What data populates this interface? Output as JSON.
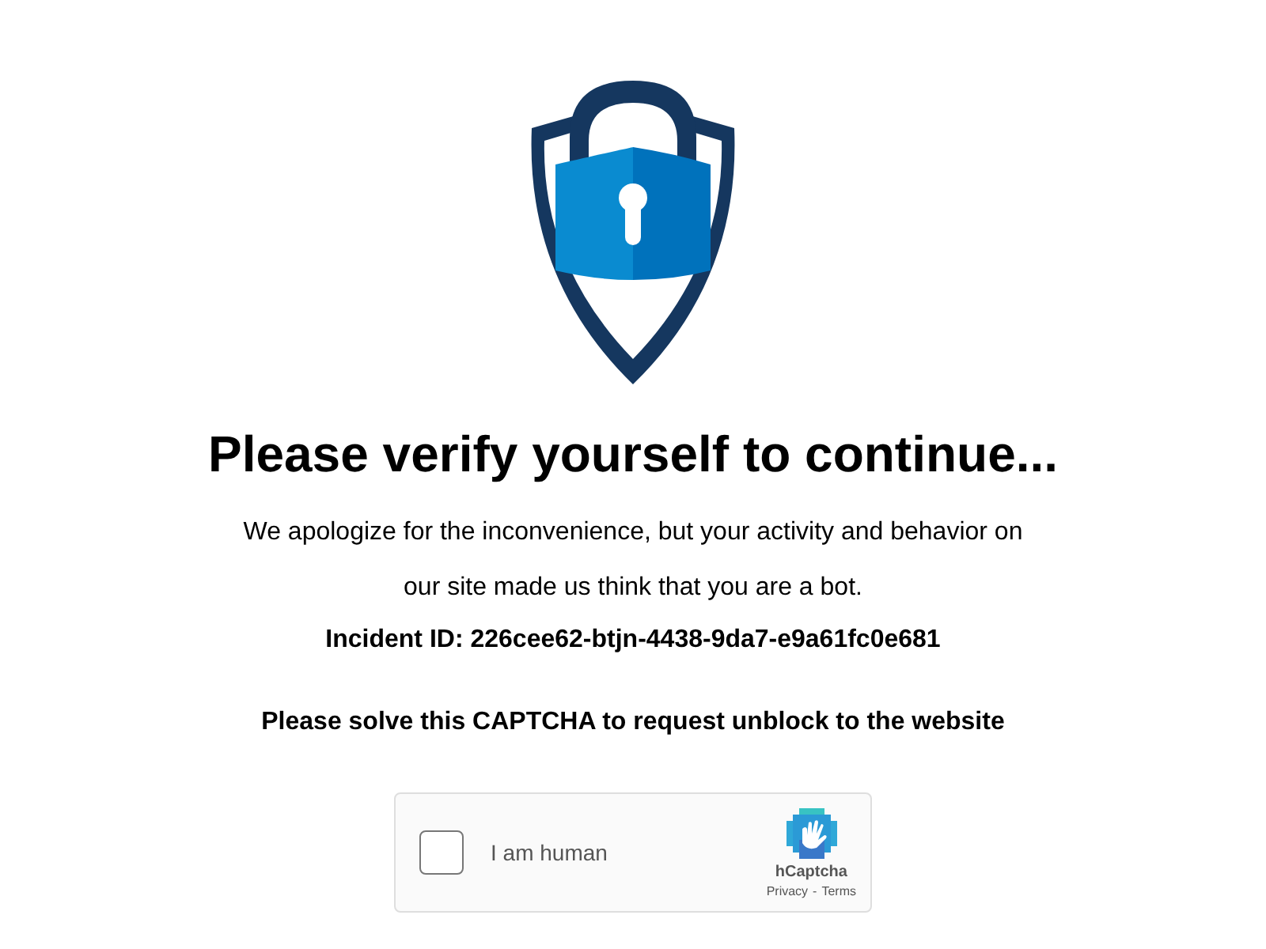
{
  "heading": "Please verify yourself to continue...",
  "message": "We apologize for the inconvenience, but your activity and behavior on our site made us think that you are a bot.",
  "incident": "Incident ID: 226cee62-btjn-4438-9da7-e9a61fc0e681",
  "instruction": "Please solve this CAPTCHA to request unblock to the website",
  "captcha": {
    "label": "I am human",
    "checked": false,
    "brand": "hCaptcha",
    "links": [
      "Privacy",
      "Terms"
    ],
    "separator": "-"
  }
}
